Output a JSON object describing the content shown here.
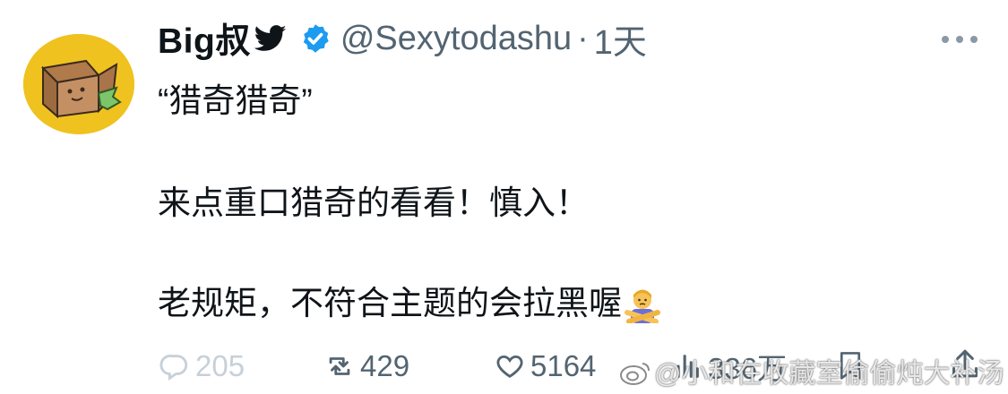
{
  "tweet": {
    "author_name": "Big叔",
    "handle": "@Sexytodashu",
    "separator": "·",
    "time": "1天",
    "lines": [
      "“猎奇猎奇”",
      "来点重口猎奇的看看！慎入！",
      "老规矩，不符合主题的会拉黑喔"
    ],
    "icons": {
      "author_badge": "bird-icon",
      "verified": "verified-badge-icon",
      "more": "more-icon",
      "emoji": "person-gesturing-no-emoji"
    }
  },
  "actions": {
    "reply_count": "205",
    "retweet_count": "429",
    "like_count": "5164",
    "views_count": "336万"
  },
  "watermark": {
    "text": "@小和在收藏室偷偷炖大补汤"
  },
  "colors": {
    "text": "#0f1419",
    "muted": "#536471",
    "verified": "#1d9bf0",
    "avatar_bg": "#efc21f"
  }
}
